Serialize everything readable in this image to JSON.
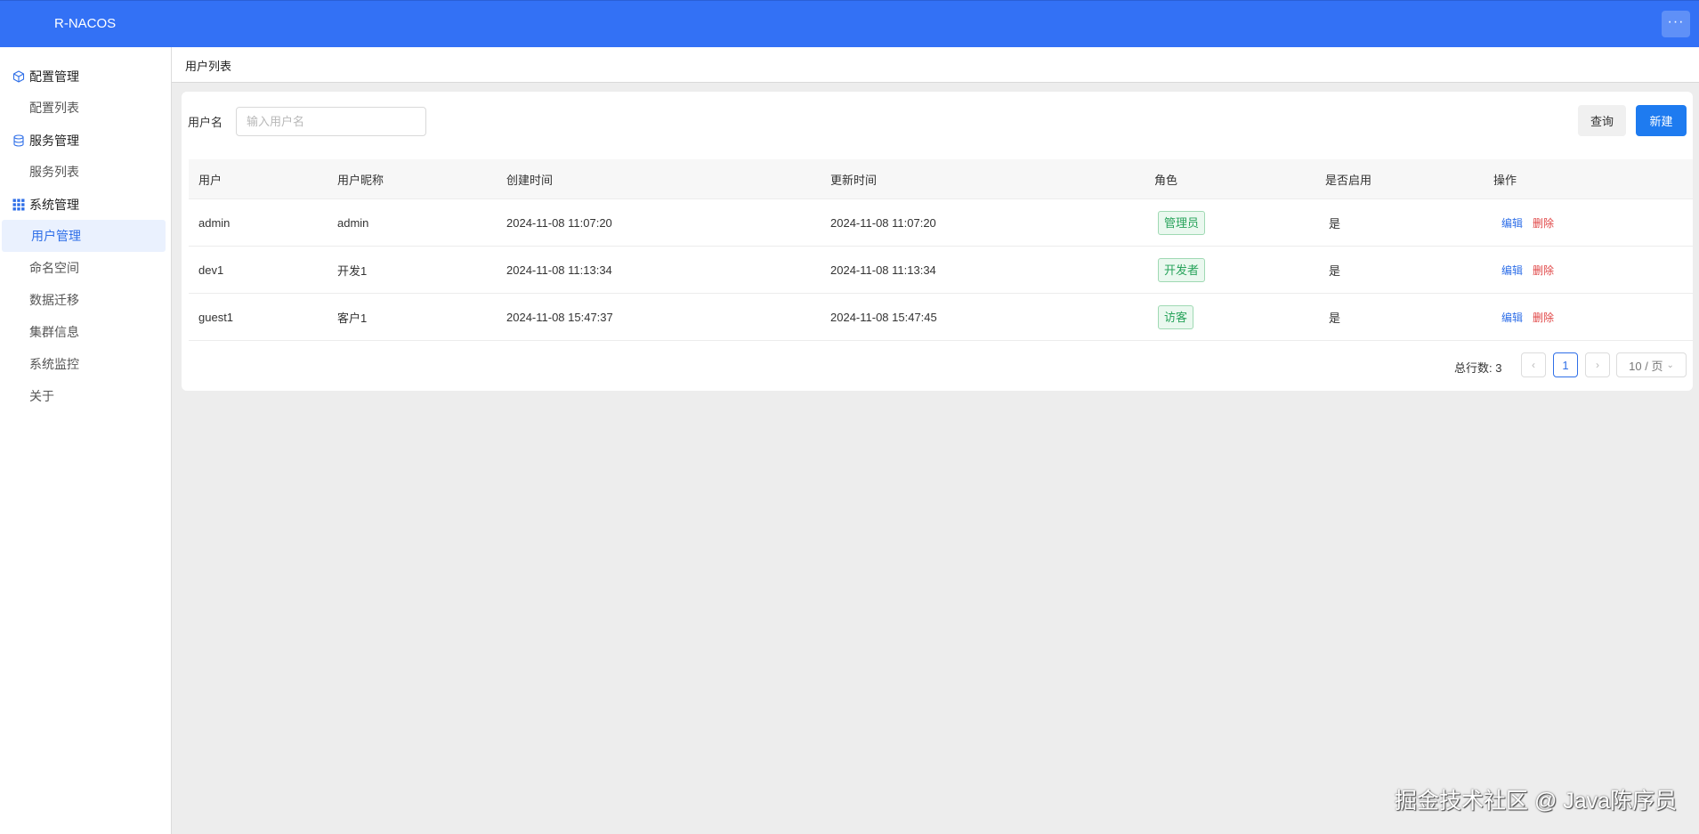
{
  "app": {
    "title": "R-NACOS",
    "more_label": "···"
  },
  "sidebar": {
    "groups": [
      {
        "label": "配置管理",
        "icon": "cube-icon",
        "items": [
          {
            "label": "配置列表"
          }
        ]
      },
      {
        "label": "服务管理",
        "icon": "database-icon",
        "items": [
          {
            "label": "服务列表"
          }
        ]
      },
      {
        "label": "系统管理",
        "icon": "grid-icon",
        "items": [
          {
            "label": "用户管理",
            "active": true
          },
          {
            "label": "命名空间"
          },
          {
            "label": "数据迁移"
          },
          {
            "label": "集群信息"
          },
          {
            "label": "系统监控"
          },
          {
            "label": "关于"
          }
        ]
      }
    ],
    "accent_color": "#2f6fe8"
  },
  "tabs": [
    {
      "label": "用户列表"
    }
  ],
  "search": {
    "label": "用户名",
    "placeholder": "输入用户名",
    "value": ""
  },
  "buttons": {
    "query": "查询",
    "create": "新建"
  },
  "table": {
    "columns": [
      "用户",
      "用户昵称",
      "创建时间",
      "更新时间",
      "角色",
      "是否启用",
      "操作"
    ],
    "rows": [
      {
        "user": "admin",
        "nickname": "admin",
        "created": "2024-11-08 11:07:20",
        "updated": "2024-11-08 11:07:20",
        "role": "管理员",
        "enabled": "是",
        "edit": "编辑",
        "delete": "删除"
      },
      {
        "user": "dev1",
        "nickname": "开发1",
        "created": "2024-11-08 11:13:34",
        "updated": "2024-11-08 11:13:34",
        "role": "开发者",
        "enabled": "是",
        "edit": "编辑",
        "delete": "删除"
      },
      {
        "user": "guest1",
        "nickname": "客户1",
        "created": "2024-11-08 15:47:37",
        "updated": "2024-11-08 15:47:45",
        "role": "访客",
        "enabled": "是",
        "edit": "编辑",
        "delete": "删除"
      }
    ]
  },
  "pagination": {
    "total": "总行数: 3",
    "current_page": "1",
    "page_size": "10 / 页",
    "prev": "‹",
    "next": "›"
  },
  "watermark": "掘金技术社区 @ Java陈序员",
  "colors": {
    "header": "#3371f5",
    "primary_button": "#1e7bf0",
    "tag_green": "#28a35b",
    "delete_red": "#e04545"
  }
}
